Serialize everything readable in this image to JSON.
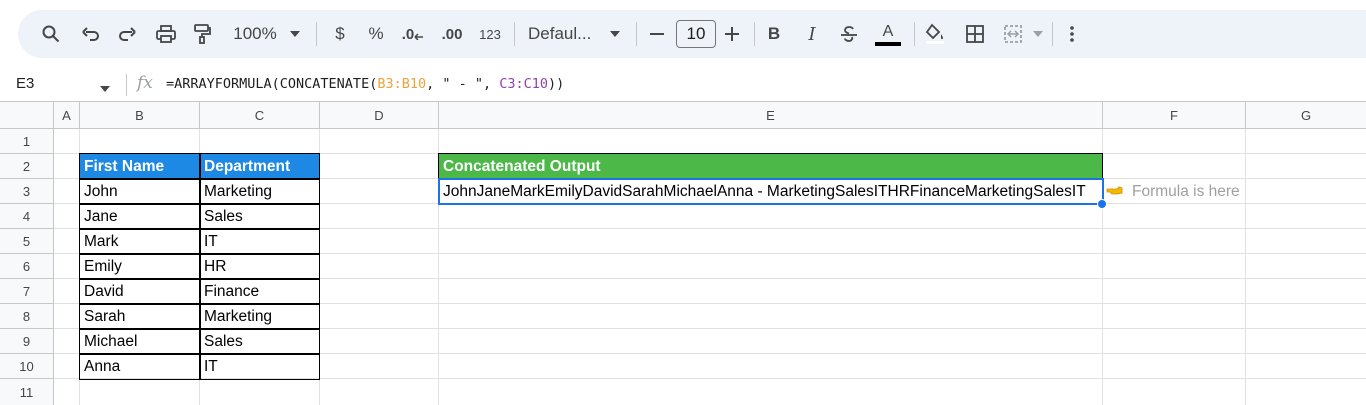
{
  "toolbar": {
    "zoom": "100%",
    "currency": "$",
    "percent": "%",
    "decrease_decimals": ".0",
    "increase_decimals": ".00",
    "number_format": "123",
    "font": "Defaul...",
    "font_size": "10",
    "bold": "B",
    "italic": "I",
    "text_color": "A",
    "text_color_hex": "#000000"
  },
  "formula_bar": {
    "cell_ref": "E3",
    "fx": "fx",
    "formula_prefix": "=ARRAYFORMULA(CONCATENATE(",
    "formula_ref1": "B3:B10",
    "formula_mid": ", \" - \", ",
    "formula_ref2": "C3:C10",
    "formula_suffix": "))"
  },
  "columns": [
    "A",
    "B",
    "C",
    "D",
    "E",
    "F",
    "G"
  ],
  "rows": [
    "1",
    "2",
    "3",
    "4",
    "5",
    "6",
    "7",
    "8",
    "9",
    "10",
    "11"
  ],
  "table": {
    "headers": [
      "First Name",
      "Department"
    ],
    "rows": [
      [
        "John",
        "Marketing"
      ],
      [
        "Jane",
        "Sales"
      ],
      [
        "Mark",
        "IT"
      ],
      [
        "Emily",
        "HR"
      ],
      [
        "David",
        "Finance"
      ],
      [
        "Sarah",
        "Marketing"
      ],
      [
        "Michael",
        "Sales"
      ],
      [
        "Anna",
        "IT"
      ]
    ],
    "header_color": "#1e88e5"
  },
  "output": {
    "header": "Concatenated Output",
    "value": "JohnJaneMarkEmilyDavidSarahMichaelAnna - MarketingSalesITHRFinanceMarketingSalesIT",
    "header_color": "#4bb848"
  },
  "annotation": {
    "icon": "pointing-hand-icon",
    "text": "Formula is here"
  },
  "selection_color": "#1a73e8"
}
